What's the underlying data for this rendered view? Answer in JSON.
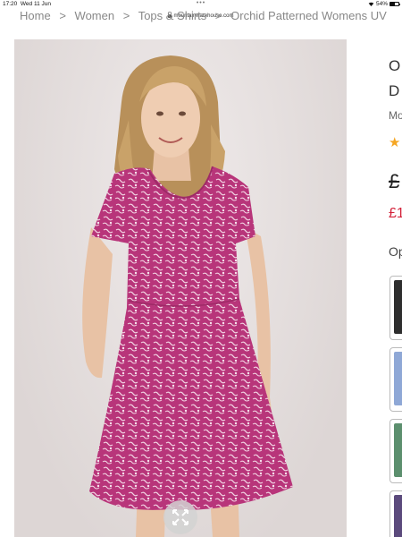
{
  "status_bar": {
    "time": "17:20",
    "date": "Wed 11 Jun",
    "battery": "54%"
  },
  "browser": {
    "url": "mountainwarehouse.com",
    "dots": "•••"
  },
  "breadcrumb": [
    "Home",
    "Women",
    "Tops & Shirts",
    "Orchid Patterned Womens UV"
  ],
  "product": {
    "title_line1": "O",
    "title_line2": "D",
    "brand_partial": "Mo",
    "price_old": "£",
    "price_new": "£1",
    "options_label": "Op"
  },
  "colors": {
    "dress": "#b8357a",
    "sale": "#d3223a",
    "star": "#f5a623"
  },
  "thumbnails": [
    {
      "name": "thumb-dark",
      "color": "#2e2e2e"
    },
    {
      "name": "thumb-blue",
      "color": "#8fa8d6"
    },
    {
      "name": "thumb-green",
      "color": "#5c8f6e"
    },
    {
      "name": "thumb-purple",
      "color": "#5b4a7c"
    }
  ]
}
